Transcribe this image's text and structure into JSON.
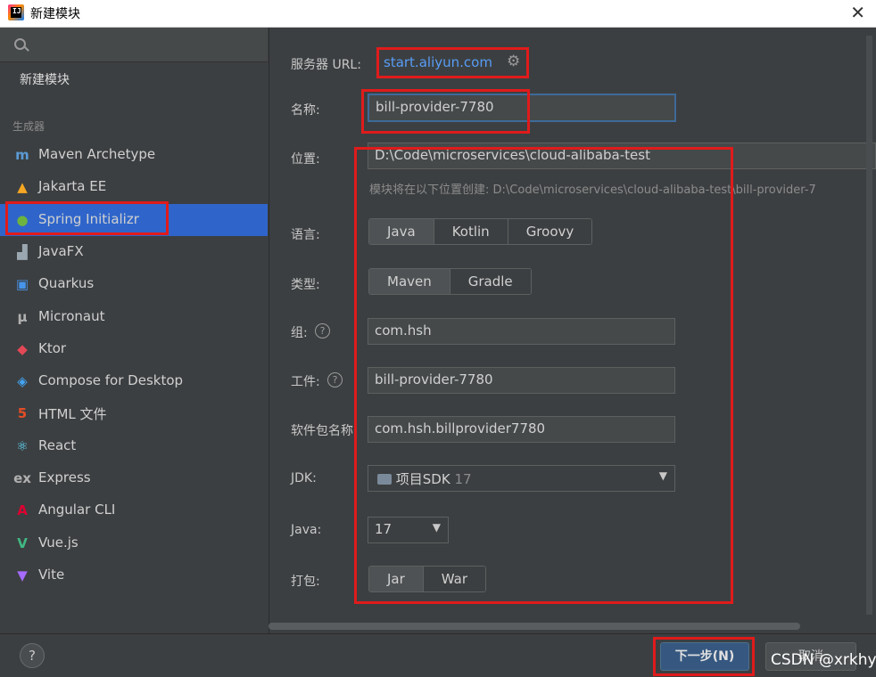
{
  "window": {
    "title": "新建模块",
    "app_icon_text": "IJ"
  },
  "sidebar": {
    "search_icon": "search-icon",
    "new_module_label": "新建模块",
    "generators_title": "生成器",
    "items": [
      {
        "label": "Maven Archetype",
        "icon": "maven-icon",
        "glyph": "m",
        "color": "#5a9bd5"
      },
      {
        "label": "Jakarta EE",
        "icon": "jakarta-icon",
        "glyph": "▲",
        "color": "#f5a623"
      },
      {
        "label": "Spring Initializr",
        "icon": "spring-icon",
        "glyph": "●",
        "color": "#6db33f"
      },
      {
        "label": "JavaFX",
        "icon": "javafx-icon",
        "glyph": "▟",
        "color": "#9aa7b0"
      },
      {
        "label": "Quarkus",
        "icon": "quarkus-icon",
        "glyph": "▣",
        "color": "#4695eb"
      },
      {
        "label": "Micronaut",
        "icon": "micronaut-icon",
        "glyph": "μ",
        "color": "#b0b0b0"
      },
      {
        "label": "Ktor",
        "icon": "ktor-icon",
        "glyph": "◆",
        "color": "#e44857"
      },
      {
        "label": "Compose for Desktop",
        "icon": "compose-icon",
        "glyph": "◈",
        "color": "#42a5f5"
      },
      {
        "label": "HTML 文件",
        "icon": "html5-icon",
        "glyph": "5",
        "color": "#e44d26"
      },
      {
        "label": "React",
        "icon": "react-icon",
        "glyph": "⚛",
        "color": "#61dafb"
      },
      {
        "label": "Express",
        "icon": "express-icon",
        "glyph": "ex",
        "color": "#b0b0b0"
      },
      {
        "label": "Angular CLI",
        "icon": "angular-icon",
        "glyph": "A",
        "color": "#dd0031"
      },
      {
        "label": "Vue.js",
        "icon": "vue-icon",
        "glyph": "V",
        "color": "#41b883"
      },
      {
        "label": "Vite",
        "icon": "vite-icon",
        "glyph": "▼",
        "color": "#a66bff"
      }
    ],
    "selected": "Spring Initializr"
  },
  "form": {
    "server_url_label": "服务器 URL:",
    "server_url_value": "start.aliyun.com",
    "name_label": "名称:",
    "name_value": "bill-provider-7780",
    "location_label": "位置:",
    "location_value": "D:\\Code\\microservices\\cloud-alibaba-test",
    "location_hint": "模块将在以下位置创建: D:\\Code\\microservices\\cloud-alibaba-test\\bill-provider-7",
    "language_label": "语言:",
    "language_options": [
      "Java",
      "Kotlin",
      "Groovy"
    ],
    "language_selected": "Java",
    "type_label": "类型:",
    "type_options": [
      "Maven",
      "Gradle"
    ],
    "type_selected": "Maven",
    "group_label": "组:",
    "group_value": "com.hsh",
    "artifact_label": "工件:",
    "artifact_value": "bill-provider-7780",
    "package_label": "软件包名称:",
    "package_value": "com.hsh.billprovider7780",
    "jdk_label": "JDK:",
    "jdk_value": "项目SDK",
    "jdk_version": "17",
    "java_label": "Java:",
    "java_value": "17",
    "packaging_label": "打包:",
    "packaging_options": [
      "Jar",
      "War"
    ],
    "packaging_selected": "Jar"
  },
  "footer": {
    "help_label": "?",
    "next_label": "下一步(N)",
    "cancel_label": "取消"
  },
  "watermark": "CSDN @xrkhy",
  "colors": {
    "selection": "#2f65ca",
    "link": "#589df6",
    "highlight_box": "#e01b1b"
  }
}
